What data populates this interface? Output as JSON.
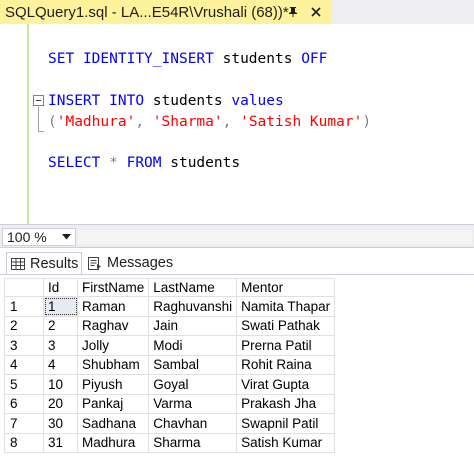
{
  "document_tab": {
    "title": "SQLQuery1.sql - LA...E54R\\Vrushali (68))*"
  },
  "editor": {
    "line1": {
      "kw1": "SET",
      "kw2": "IDENTITY_INSERT",
      "table": " students ",
      "kw3": "OFF"
    },
    "line2": {
      "kw1": "INSERT",
      "kw2": "INTO",
      "table": " students ",
      "kw3": "values"
    },
    "line3": {
      "open": "(",
      "v1": "'Madhura'",
      "sep1": ", ",
      "v2": "'Sharma'",
      "sep2": ", ",
      "v3": "'Satish Kumar'",
      "close": ")"
    },
    "line4": {
      "kw1": "SELECT",
      "star": " * ",
      "kw2": "FROM",
      "table": " students"
    }
  },
  "zoom": {
    "value": "100 %"
  },
  "results_tabs": {
    "results": "Results",
    "messages": "Messages"
  },
  "grid": {
    "columns": [
      "Id",
      "FirstName",
      "LastName",
      "Mentor"
    ],
    "rows": [
      [
        "1",
        "1",
        "Raman",
        "Raghuvanshi",
        "Namita Thapar"
      ],
      [
        "2",
        "2",
        "Raghav",
        "Jain",
        "Swati Pathak"
      ],
      [
        "3",
        "3",
        "Jolly",
        "Modi",
        "Prerna Patil"
      ],
      [
        "4",
        "4",
        "Shubham",
        "Sambal",
        "Rohit Raina"
      ],
      [
        "5",
        "10",
        "Piyush",
        "Goyal",
        "Virat Gupta"
      ],
      [
        "6",
        "20",
        "Pankaj",
        "Varma",
        "Prakash Jha"
      ],
      [
        "7",
        "30",
        "Sadhana",
        "Chavhan",
        "Swapnil Patil"
      ],
      [
        "8",
        "31",
        "Madhura",
        "Sharma",
        "Satish Kumar"
      ]
    ]
  },
  "colors": {
    "tab_active": "#fff29d",
    "keyword": "#0000ff",
    "string": "#ff0000",
    "margin_bar": "#c8e6a0"
  },
  "icons": {
    "pin": "pin-icon",
    "close": "close-icon",
    "zoom_dropdown": "chevron-down-icon",
    "results": "grid-icon",
    "messages": "messages-icon"
  }
}
